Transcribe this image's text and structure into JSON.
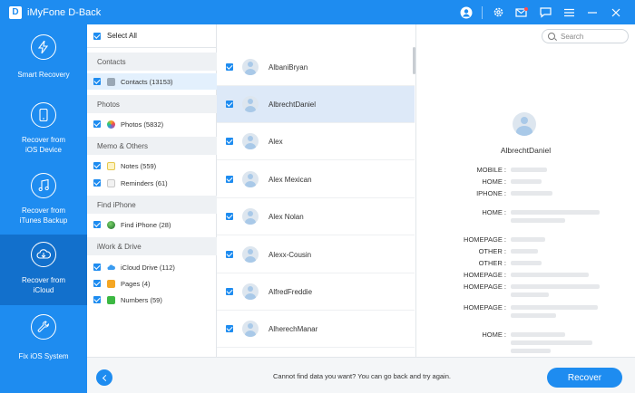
{
  "app": {
    "title": "iMyFone D-Back",
    "logo_letter": "D"
  },
  "titlebar_icons": [
    "user-icon",
    "gear-icon",
    "mail-icon",
    "feedback-icon",
    "menu-icon",
    "minimize-icon",
    "close-icon"
  ],
  "sidebar": {
    "items": [
      {
        "label": "Smart Recovery",
        "icon": "lightning-icon"
      },
      {
        "label": "Recover from\niOS Device",
        "icon": "phone-icon"
      },
      {
        "label": "Recover from\niTunes Backup",
        "icon": "music-icon"
      },
      {
        "label": "Recover from\niCloud",
        "icon": "cloud-icon",
        "active": true
      },
      {
        "label": "Fix iOS System",
        "icon": "wrench-icon"
      }
    ]
  },
  "categories": {
    "select_all": "Select All",
    "groups": [
      {
        "header": "Contacts",
        "items": [
          {
            "label": "Contacts (13153)",
            "icon": "contacts-icon",
            "active": true
          }
        ]
      },
      {
        "header": "Photos",
        "items": [
          {
            "label": "Photos (5832)",
            "icon": "photos-icon"
          }
        ]
      },
      {
        "header": "Memo & Others",
        "items": [
          {
            "label": "Notes (559)",
            "icon": "notes-icon"
          },
          {
            "label": "Reminders (61)",
            "icon": "reminders-icon"
          }
        ]
      },
      {
        "header": "Find iPhone",
        "items": [
          {
            "label": "Find iPhone (28)",
            "icon": "find-iphone-icon"
          }
        ]
      },
      {
        "header": "iWork & Drive",
        "items": [
          {
            "label": "iCloud Drive (112)",
            "icon": "icloud-drive-icon"
          },
          {
            "label": "Pages (4)",
            "icon": "pages-icon"
          },
          {
            "label": "Numbers (59)",
            "icon": "numbers-icon"
          }
        ]
      }
    ]
  },
  "contacts": [
    {
      "name": "AlbaniBryan"
    },
    {
      "name": "AlbrechtDaniel",
      "active": true
    },
    {
      "name": "Alex"
    },
    {
      "name": "Alex Mexican"
    },
    {
      "name": "Alex Nolan"
    },
    {
      "name": "Alexx-Cousin"
    },
    {
      "name": "AlfredFreddie"
    },
    {
      "name": "AlherechManar"
    }
  ],
  "search": {
    "placeholder": "Search"
  },
  "detail": {
    "name": "AlbrechtDaniel",
    "fields": [
      "MOBILE :",
      "HOME :",
      "IPHONE :",
      "HOME :",
      "HOMEPAGE :",
      "OTHER :",
      "OTHER :",
      "HOMEPAGE :",
      "HOMEPAGE :",
      "HOMEPAGE :",
      "HOME :"
    ]
  },
  "footer": {
    "hint": "Cannot find data you want? You can go back and try again.",
    "recover_label": "Recover"
  },
  "colors": {
    "accent": "#1e8cf0",
    "sidebar_active": "#1270cc",
    "row_active": "#dde9f8"
  }
}
